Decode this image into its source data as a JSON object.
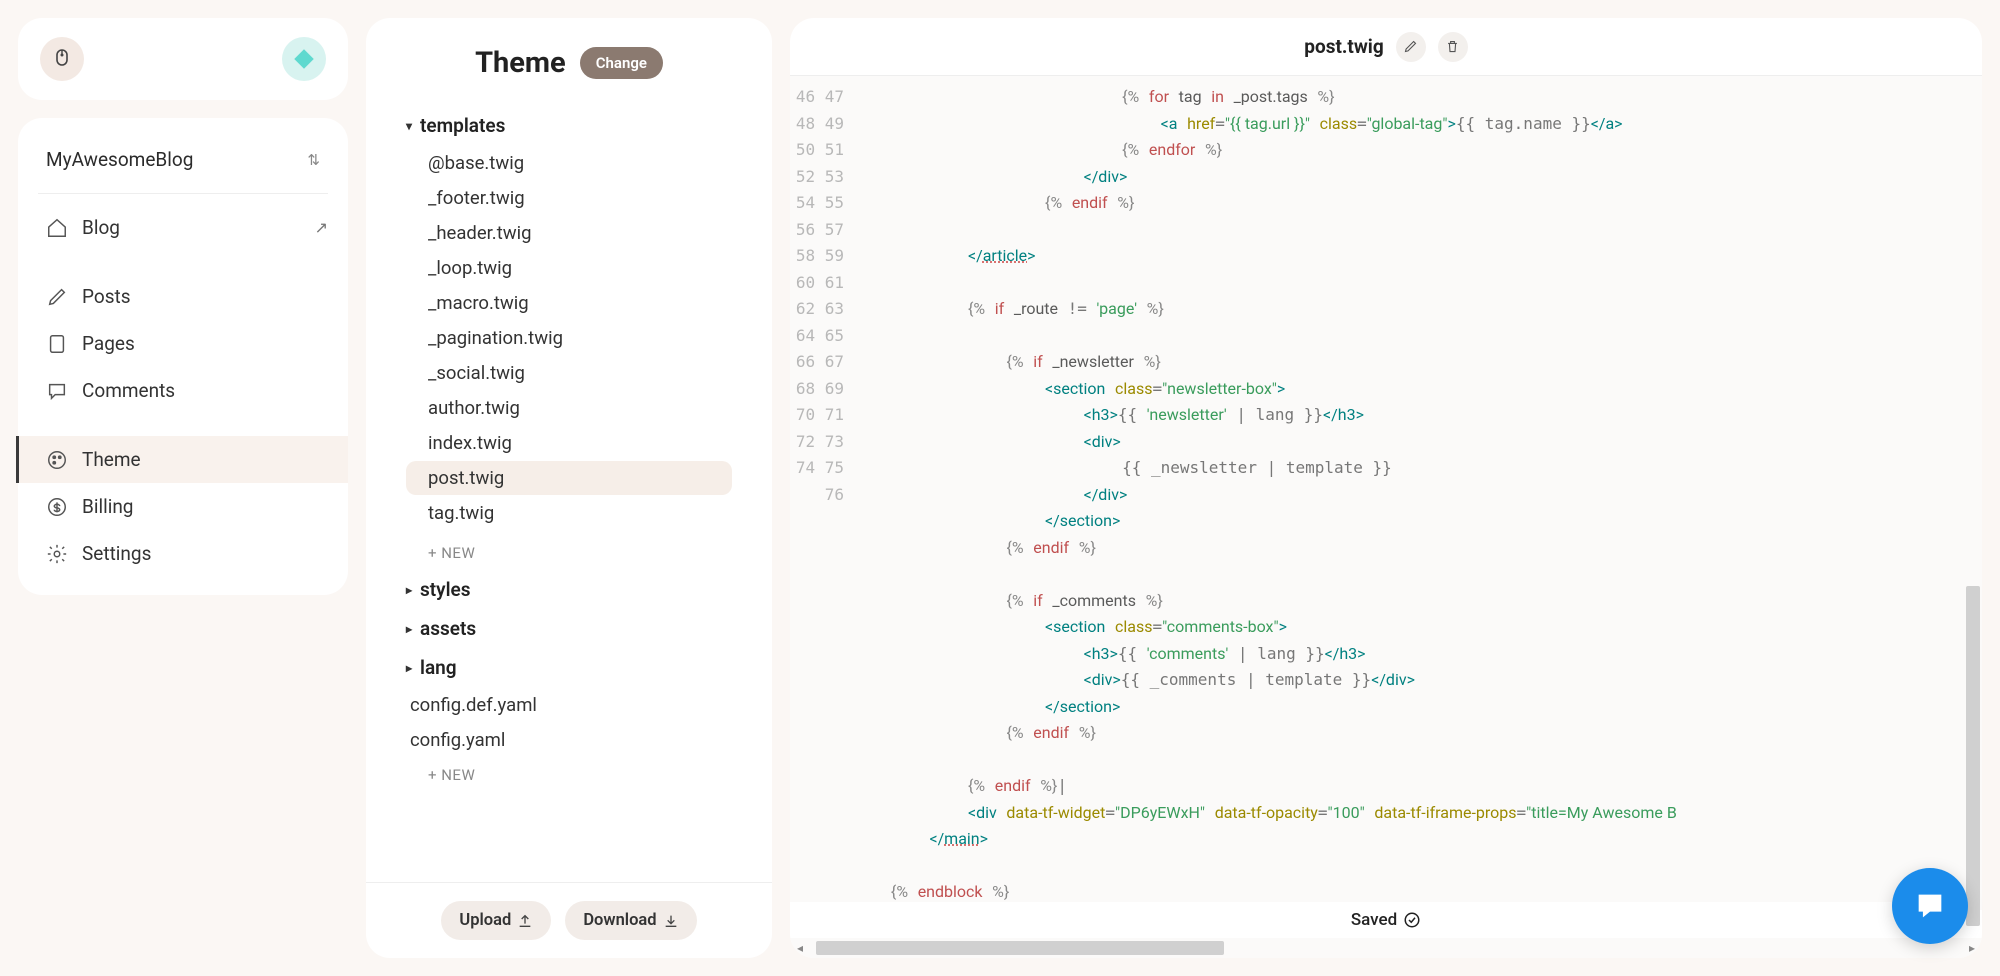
{
  "site_name": "MyAwesomeBlog",
  "nav": {
    "blog": "Blog",
    "posts": "Posts",
    "pages": "Pages",
    "comments": "Comments",
    "theme": "Theme",
    "billing": "Billing",
    "settings": "Settings"
  },
  "theme_panel": {
    "title": "Theme",
    "change": "Change",
    "folders": {
      "templates": "templates",
      "styles": "styles",
      "assets": "assets",
      "lang": "lang"
    },
    "templates": [
      "@base.twig",
      "_footer.twig",
      "_header.twig",
      "_loop.twig",
      "_macro.twig",
      "_pagination.twig",
      "_social.twig",
      "author.twig",
      "index.twig",
      "post.twig",
      "tag.twig"
    ],
    "new_label": "+  NEW",
    "root_files": [
      "config.def.yaml",
      "config.yaml"
    ],
    "upload": "Upload",
    "download": "Download"
  },
  "editor": {
    "filename": "post.twig",
    "saved": "Saved",
    "line_start": 46,
    "line_end": 76,
    "code_lines": [
      {
        "n": 46,
        "html": "                           <span class='t-br'>{%</span> <span class='t-kw'>for</span> <span class='t-name'>tag</span> <span class='t-kw'>in</span> <span class='t-name'>_post.tags</span> <span class='t-br'>%}</span>"
      },
      {
        "n": 47,
        "html": "                               <span class='t-tag'>&lt;a</span> <span class='t-attr'>href</span>=<span class='t-str'>\"{{ tag.url }}\"</span> <span class='t-attr'>class</span>=<span class='t-str'>\"global-tag\"</span><span class='t-tag'>&gt;</span>{{ tag.name }}<span class='t-tag'>&lt;/a&gt;</span>"
      },
      {
        "n": 48,
        "html": "                           <span class='t-br'>{%</span> <span class='t-kw'>endfor</span> <span class='t-br'>%}</span>"
      },
      {
        "n": 49,
        "html": "                       <span class='t-tag'>&lt;/div&gt;</span>"
      },
      {
        "n": 50,
        "html": "                   <span class='t-br'>{%</span> <span class='t-kw'>endif</span> <span class='t-br'>%}</span>"
      },
      {
        "n": 51,
        "html": ""
      },
      {
        "n": 52,
        "html": "           <span class='t-tag'>&lt;/<span class='underline'>article</span>&gt;</span>"
      },
      {
        "n": 53,
        "html": ""
      },
      {
        "n": 54,
        "html": "           <span class='t-br'>{%</span> <span class='t-kw'>if</span> <span class='t-name'>_route</span> != <span class='t-str'>'page'</span> <span class='t-br'>%}</span>"
      },
      {
        "n": 55,
        "html": ""
      },
      {
        "n": 56,
        "html": "               <span class='t-br'>{%</span> <span class='t-kw'>if</span> <span class='t-name'>_newsletter</span> <span class='t-br'>%}</span>"
      },
      {
        "n": 57,
        "html": "                   <span class='t-tag'>&lt;section</span> <span class='t-attr'>class</span>=<span class='t-str'>\"newsletter-box\"</span><span class='t-tag'>&gt;</span>"
      },
      {
        "n": 58,
        "html": "                       <span class='t-tag'>&lt;h3&gt;</span>{{ <span class='t-str'>'newsletter'</span> | lang }}<span class='t-tag'>&lt;/h3&gt;</span>"
      },
      {
        "n": 59,
        "html": "                       <span class='t-tag'>&lt;div&gt;</span>"
      },
      {
        "n": 60,
        "html": "                           {{ _newsletter | template }}"
      },
      {
        "n": 61,
        "html": "                       <span class='t-tag'>&lt;/div&gt;</span>"
      },
      {
        "n": 62,
        "html": "                   <span class='t-tag'>&lt;/section&gt;</span>"
      },
      {
        "n": 63,
        "html": "               <span class='t-br'>{%</span> <span class='t-kw'>endif</span> <span class='t-br'>%}</span>"
      },
      {
        "n": 64,
        "html": ""
      },
      {
        "n": 65,
        "html": "               <span class='t-br'>{%</span> <span class='t-kw'>if</span> <span class='t-name'>_comments</span> <span class='t-br'>%}</span>"
      },
      {
        "n": 66,
        "html": "                   <span class='t-tag'>&lt;section</span> <span class='t-attr'>class</span>=<span class='t-str'>\"comments-box\"</span><span class='t-tag'>&gt;</span>"
      },
      {
        "n": 67,
        "html": "                       <span class='t-tag'>&lt;h3&gt;</span>{{ <span class='t-str'>'comments'</span> | lang }}<span class='t-tag'>&lt;/h3&gt;</span>"
      },
      {
        "n": 68,
        "html": "                       <span class='t-tag'>&lt;div&gt;</span>{{ _comments | template }}<span class='t-tag'>&lt;/div&gt;</span>"
      },
      {
        "n": 69,
        "html": "                   <span class='t-tag'>&lt;/section&gt;</span>"
      },
      {
        "n": 70,
        "html": "               <span class='t-br'>{%</span> <span class='t-kw'>endif</span> <span class='t-br'>%}</span>"
      },
      {
        "n": 71,
        "html": ""
      },
      {
        "n": 72,
        "html": "           <span class='t-br'>{%</span> <span class='t-kw'>endif</span> <span class='t-br'>%}</span>|"
      },
      {
        "n": 73,
        "html": "           <span class='t-tag'>&lt;div</span> <span class='t-attr'>data-tf-widget</span>=<span class='t-str'>\"DP6yEWxH\"</span> <span class='t-attr'>data-tf-opacity</span>=<span class='t-str'>\"100\"</span> <span class='t-attr'>data-tf-iframe-props</span>=<span class='t-str'>\"title=My Awesome B</span>"
      },
      {
        "n": 74,
        "html": "       <span class='t-tag'>&lt;/<span class='underline'>main</span>&gt;</span>"
      },
      {
        "n": 75,
        "html": ""
      },
      {
        "n": 76,
        "html": "   <span class='t-br'>{%</span> <span class='t-kw'>endblock</span> <span class='t-br'>%}</span>"
      }
    ]
  }
}
